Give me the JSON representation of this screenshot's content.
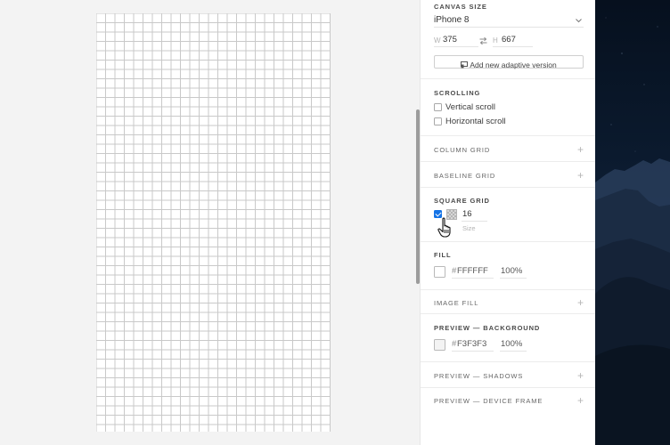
{
  "canvas_size": {
    "title": "CANVAS SIZE",
    "device": "iPhone 8",
    "width_label": "W",
    "width_value": "375",
    "height_label": "H",
    "height_value": "667",
    "add_adaptive_label": "Add new adaptive version"
  },
  "scrolling": {
    "title": "SCROLLING",
    "vertical_label": "Vertical scroll",
    "vertical_checked": false,
    "horizontal_label": "Horizontal scroll",
    "horizontal_checked": false
  },
  "column_grid": {
    "title": "COLUMN GRID"
  },
  "baseline_grid": {
    "title": "BASELINE GRID"
  },
  "square_grid": {
    "title": "SQUARE GRID",
    "enabled": true,
    "size_value": "16",
    "size_label": "Size"
  },
  "fill": {
    "title": "FILL",
    "hash": "#",
    "color_hex": "FFFFFF",
    "opacity": "100%",
    "swatch_color": "#ffffff"
  },
  "image_fill": {
    "title": "IMAGE FILL"
  },
  "preview_background": {
    "title": "PREVIEW — BACKGROUND",
    "hash": "#",
    "color_hex": "F3F3F3",
    "opacity": "100%",
    "swatch_color": "#f3f3f3"
  },
  "preview_shadows": {
    "title": "PREVIEW — SHADOWS"
  },
  "preview_device_frame": {
    "title": "PREVIEW — DEVICE FRAME"
  },
  "colors": {
    "accent": "#1473e6",
    "grid_line": "#c9c9c9",
    "canvas_bg": "#f3f3f3"
  },
  "icons": {
    "chevron": "chevron-down-icon",
    "swap": "swap-dimensions-icon",
    "adaptive": "adaptive-device-icon",
    "plus": "plus-icon",
    "cursor": "hand-pointer-cursor-icon"
  }
}
